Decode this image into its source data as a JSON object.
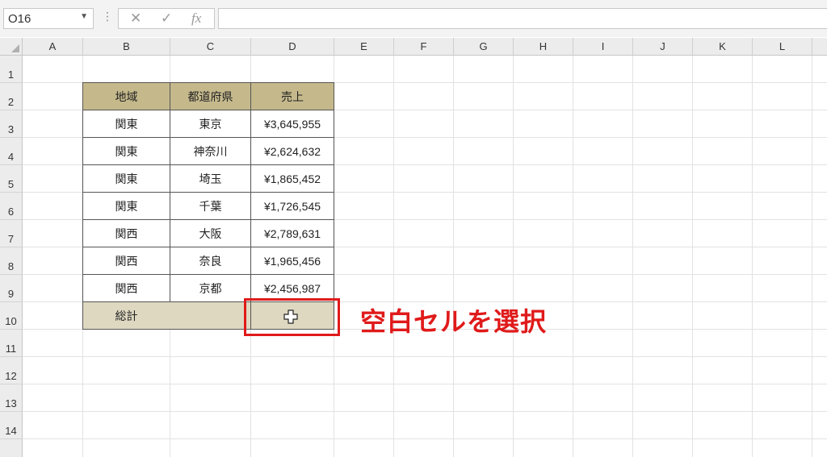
{
  "formula_bar": {
    "name_box": "O16",
    "cancel_icon": "✕",
    "confirm_icon": "✓",
    "fx_label": "fx",
    "formula": ""
  },
  "columns": [
    "A",
    "B",
    "C",
    "D",
    "E",
    "F",
    "G",
    "H",
    "I",
    "J",
    "K",
    "L"
  ],
  "rows": [
    "1",
    "2",
    "3",
    "4",
    "5",
    "6",
    "7",
    "8",
    "9",
    "10",
    "11",
    "12",
    "13",
    "14"
  ],
  "table": {
    "headers": [
      "地域",
      "都道府県",
      "売上"
    ],
    "rows": [
      [
        "関東",
        "東京",
        "¥3,645,955"
      ],
      [
        "関東",
        "神奈川",
        "¥2,624,632"
      ],
      [
        "関東",
        "埼玉",
        "¥1,865,452"
      ],
      [
        "関東",
        "千葉",
        "¥1,726,545"
      ],
      [
        "関西",
        "大阪",
        "¥2,789,631"
      ],
      [
        "関西",
        "奈良",
        "¥1,965,456"
      ],
      [
        "関西",
        "京都",
        "¥2,456,987"
      ]
    ],
    "total_label": "総計",
    "total_value": ""
  },
  "annotation": "空白セルを選択",
  "colors": {
    "header_fill": "#c5b98c",
    "total_fill": "#ded8c1",
    "annotation": "#e01a1a"
  }
}
